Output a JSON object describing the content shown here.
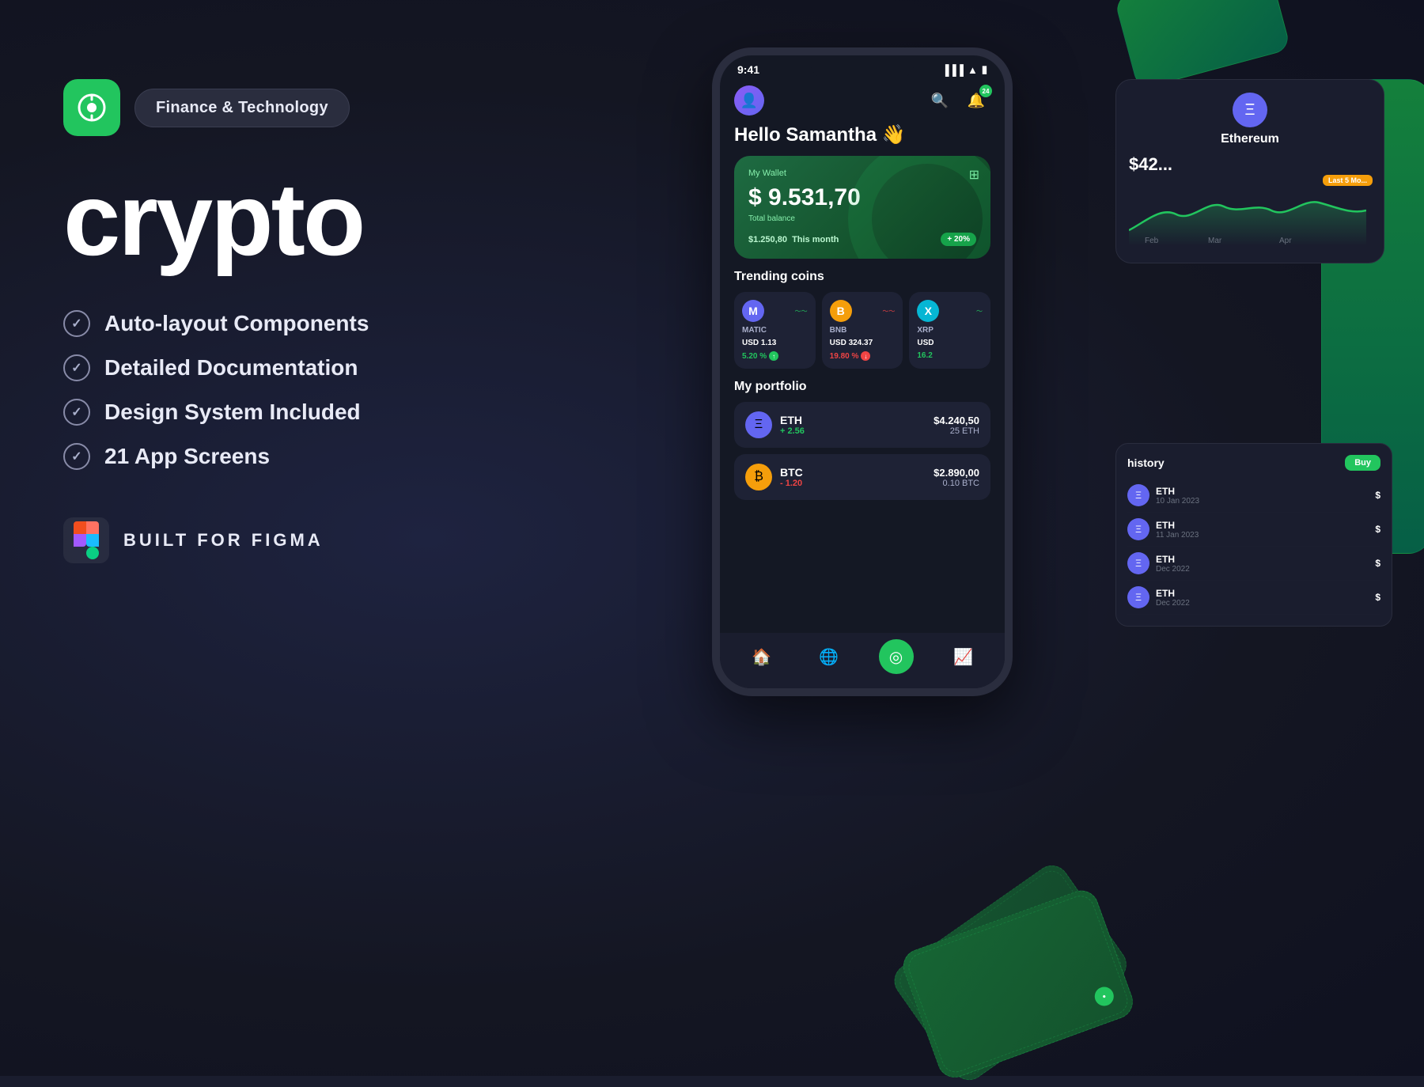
{
  "app": {
    "title": "crypto",
    "category_badge": "Finance & Technology",
    "icon_symbol": "◎"
  },
  "features": [
    {
      "id": 1,
      "label": "Auto-layout Components"
    },
    {
      "id": 2,
      "label": "Detailed Documentation"
    },
    {
      "id": 3,
      "label": "Design System Included"
    },
    {
      "id": 4,
      "label": "21 App Screens"
    }
  ],
  "figma": {
    "label": "BUILT FOR FIGMA"
  },
  "phone": {
    "status_time": "9:41",
    "greeting": "Hello Samantha 👋",
    "wallet": {
      "label": "My Wallet",
      "amount": "$ 9.531,70",
      "sub_label": "Total balance",
      "month_amount": "$1.250,80",
      "month_label": "This month",
      "badge": "+ 20%"
    },
    "trending_title": "Trending coins",
    "coins": [
      {
        "name": "MATIC",
        "price": "USD 1.13",
        "change": "5.20 %",
        "up": true,
        "symbol": "M"
      },
      {
        "name": "BNB",
        "price": "USD 324.37",
        "change": "19.80 %",
        "up": false,
        "symbol": "B"
      },
      {
        "name": "XRP",
        "price": "USD",
        "change": "16.2",
        "up": true,
        "symbol": "X"
      }
    ],
    "portfolio_title": "My portfolio",
    "portfolio": [
      {
        "symbol": "ETH",
        "change": "+ 2.56",
        "up": true,
        "value": "$4.240,50",
        "amount": "25 ETH",
        "icon": "Ξ"
      },
      {
        "symbol": "BTC",
        "change": "- 1.20",
        "up": false,
        "value": "$2.890,00",
        "amount": "0.10 BTC",
        "icon": "₿"
      }
    ]
  },
  "ethereum_panel": {
    "name": "Ethereum",
    "price": "$4..."
  },
  "history": {
    "title": "history",
    "buy_label": "Buy",
    "rows": [
      {
        "coin": "ETH",
        "date": "10 Jan 2023",
        "value": "$"
      },
      {
        "coin": "ETH",
        "date": "11 Jan 2023",
        "value": "$"
      },
      {
        "coin": "ETH",
        "date": "Dec 2022",
        "value": "$"
      },
      {
        "coin": "ETH",
        "date": "Dec 2022",
        "value": "$"
      }
    ]
  },
  "colors": {
    "brand_green": "#22c55e",
    "bg_dark": "#141824",
    "bg_medium": "#1a1d2e",
    "bg_card": "#1e2235",
    "text_primary": "#ffffff",
    "text_secondary": "#aab0cc"
  }
}
